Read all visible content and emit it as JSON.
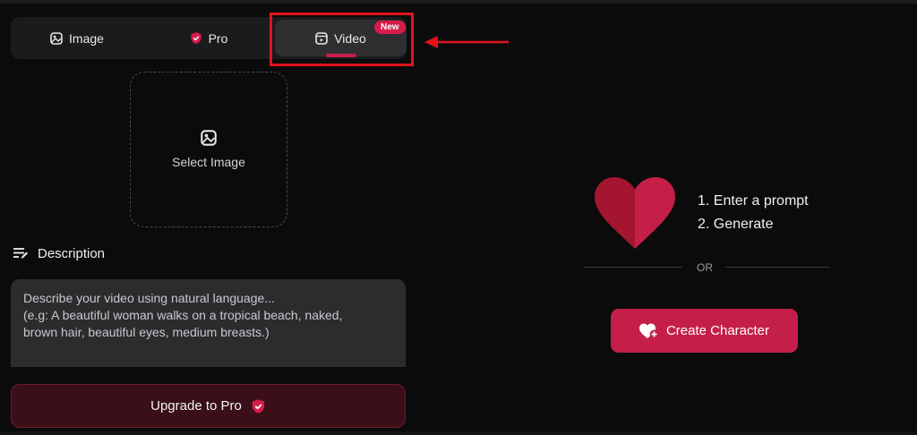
{
  "tabs": {
    "image": {
      "label": "Image",
      "icon": "image-icon"
    },
    "pro": {
      "label": "Pro",
      "icon": "shield-check-icon"
    },
    "video": {
      "label": "Video",
      "icon": "video-icon",
      "badge": "New",
      "selected": true
    }
  },
  "upload": {
    "label": "Select Image",
    "icon": "image-icon"
  },
  "description": {
    "title": "Description",
    "icon": "edit-lines-icon",
    "placeholder": "Describe your video using natural language...\n(e.g: A beautiful woman walks on a tropical beach, naked,\nbrown hair, beautiful eyes, medium breasts.)"
  },
  "upgrade": {
    "label": "Upgrade to Pro",
    "icon": "shield-check-icon"
  },
  "steps": {
    "step1": "1. Enter a prompt",
    "step2": "2. Generate"
  },
  "divider": {
    "label": "OR"
  },
  "create": {
    "label": "Create Character",
    "icon": "heart-plus-icon"
  },
  "colors": {
    "accent": "#c41f48",
    "badge": "#d81b4a",
    "annotation": "#e3121b",
    "background": "#0b0b0c",
    "panel": "#1b1b1d"
  }
}
